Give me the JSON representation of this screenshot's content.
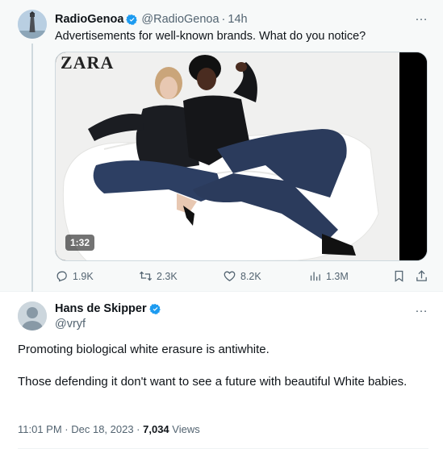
{
  "tweet1": {
    "display_name": "RadioGenoa",
    "handle": "@RadioGenoa",
    "separator": "·",
    "time": "14h",
    "text": "Advertisements for well-known brands. What do you notice?",
    "media": {
      "brand_logo": "ZARA",
      "duration": "1:32"
    },
    "actions": {
      "replies": "1.9K",
      "reposts": "2.3K",
      "likes": "8.2K",
      "views": "1.3M"
    },
    "more_icon": "…"
  },
  "tweet2": {
    "display_name": "Hans de Skipper",
    "handle": "@vryf",
    "paragraph1": "Promoting biological white erasure is antiwhite.",
    "paragraph2": "Those defending it don't want to see a future with beautiful White babies.",
    "timestamp": "11:01 PM · Dec 18, 2023 · ",
    "views_count": "7,034",
    "views_label": " Views",
    "more_icon": "…"
  },
  "colors": {
    "verified": "#1d9bf0",
    "muted": "#536471",
    "text": "#0f1419"
  }
}
